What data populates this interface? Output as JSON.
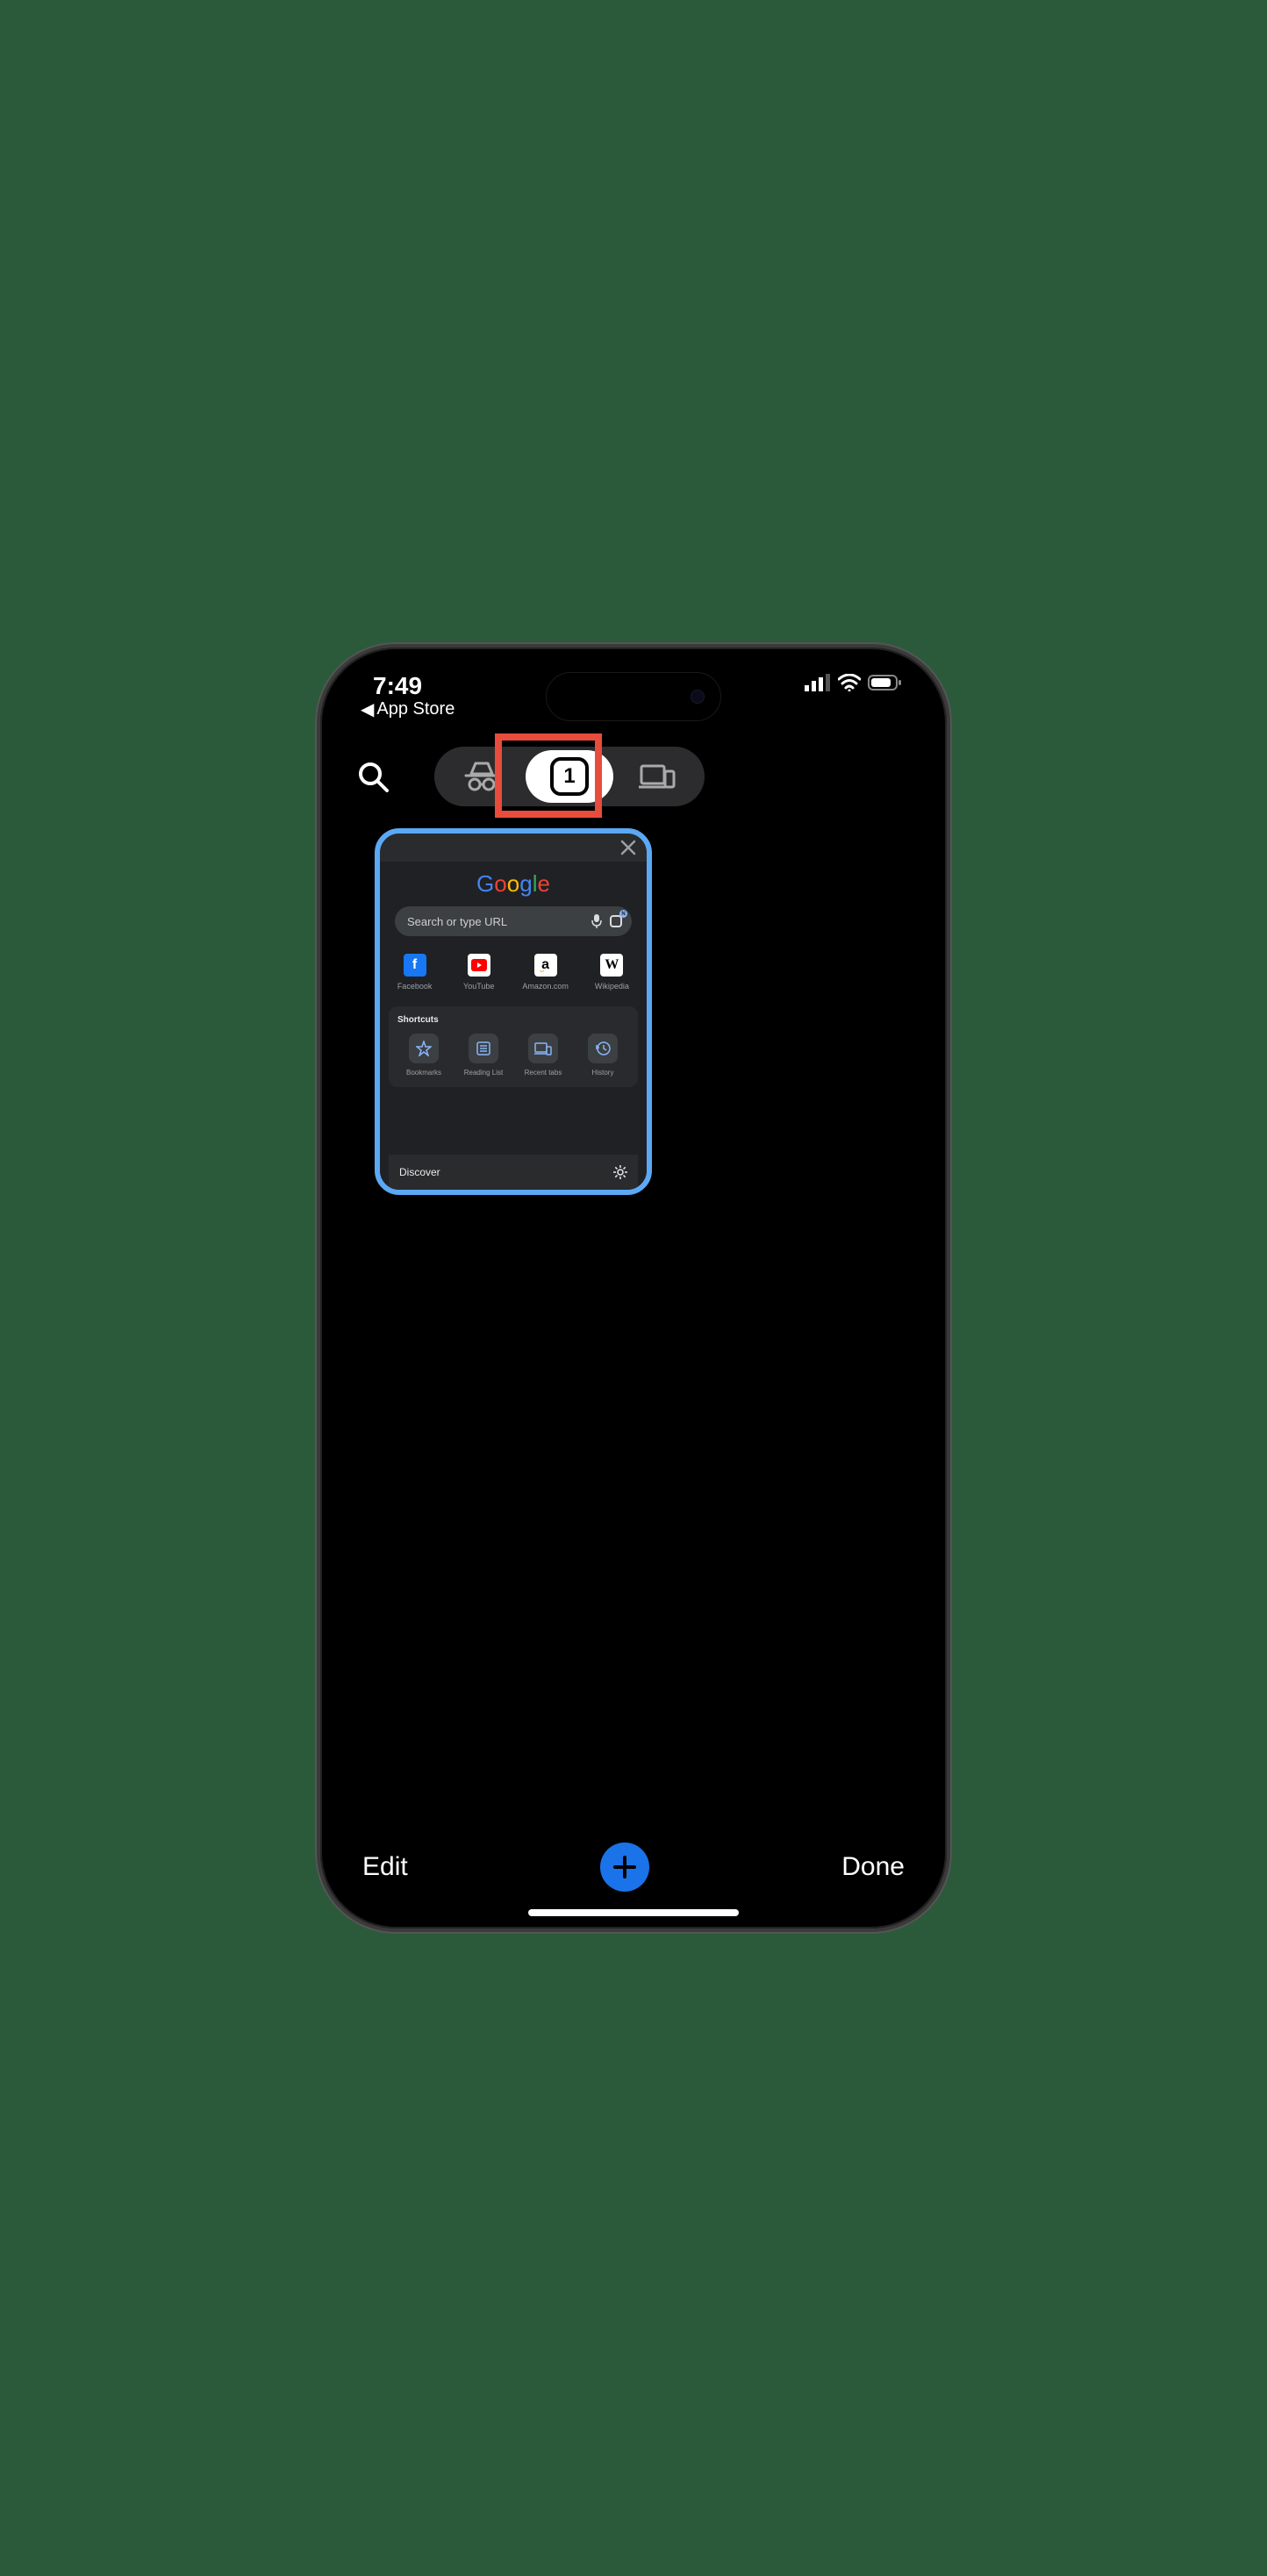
{
  "status": {
    "time": "7:49",
    "back_label": "App Store"
  },
  "toolbar": {
    "tab_count": "1"
  },
  "tab": {
    "search_placeholder": "Search or type URL",
    "sites": [
      {
        "label": "Facebook"
      },
      {
        "label": "YouTube"
      },
      {
        "label": "Amazon.com"
      },
      {
        "label": "Wikipedia"
      }
    ],
    "shortcuts_title": "Shortcuts",
    "shortcuts": [
      {
        "label": "Bookmarks"
      },
      {
        "label": "Reading List"
      },
      {
        "label": "Recent tabs"
      },
      {
        "label": "History"
      }
    ],
    "discover_label": "Discover"
  },
  "bottom": {
    "edit": "Edit",
    "done": "Done"
  }
}
